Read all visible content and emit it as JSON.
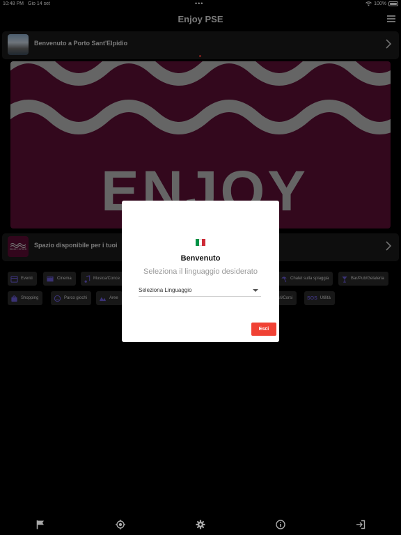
{
  "status_bar": {
    "time": "10:48 PM",
    "date": "Gio 14 set",
    "battery": "100%"
  },
  "header": {
    "title": "Enjoy PSE"
  },
  "welcome_card": {
    "text": "Benvenuto a Porto Sant'Elpidio"
  },
  "banner": {
    "text": "ENJOY"
  },
  "sponsor_card": {
    "text": "Spazio disponibile per i tuoi",
    "logo_text": "ENJOY CITIES"
  },
  "categories": [
    {
      "label": "Eventi",
      "icon": "calendar-icon"
    },
    {
      "label": "Cinema",
      "icon": "film-icon"
    },
    {
      "label": "Musica/Conce",
      "icon": "music-icon"
    },
    {
      "label": "Chalet sulla spiaggia",
      "icon": "beach-icon"
    },
    {
      "label": "Bar/Pub/Gelateria",
      "icon": "cocktail-icon"
    },
    {
      "label": "Shopping",
      "icon": "shopping-bag-icon"
    },
    {
      "label": "Parco giochi",
      "icon": "smile-icon"
    },
    {
      "label": "Aree",
      "icon": "area-icon"
    },
    {
      "label": "ari/Corsi",
      "icon": "course-icon"
    },
    {
      "label": "Utilità",
      "icon": "sos-icon",
      "badge": "SOS"
    }
  ],
  "dialog": {
    "title": "Benvenuto",
    "subtitle": "Seleziona il linguaggio desiderato",
    "select_value": "Seleziona Linguaggio",
    "exit_label": "Esci",
    "flag_colors": [
      "#009246",
      "#ffffff",
      "#ce2b37"
    ],
    "exit_color": "#f04134"
  },
  "bottom_nav": [
    {
      "icon": "flag-icon"
    },
    {
      "icon": "location-target-icon"
    },
    {
      "icon": "gear-icon"
    },
    {
      "icon": "info-icon"
    },
    {
      "icon": "logout-icon"
    }
  ],
  "colors": {
    "accent": "#6b5bd6",
    "banner_bg": "#5e0f35",
    "banner_text": "#b9b9b9"
  }
}
